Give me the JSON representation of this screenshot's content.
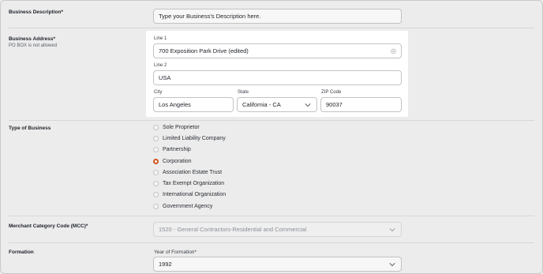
{
  "business_description": {
    "label": "Business Description*",
    "placeholder": "Type your Business's Description here."
  },
  "business_address": {
    "label": "Business Address*",
    "note": "PO BOX is not allowed",
    "line1_label": "Line 1",
    "line1_value": "700 Exposition Park Drive (edited)",
    "line2_label": "Line 2",
    "line2_value": "USA",
    "city_label": "City",
    "city_value": "Los Angeles",
    "state_label": "State",
    "state_value": "California - CA",
    "zip_label": "ZIP Code",
    "zip_value": "90037"
  },
  "type_of_business": {
    "label": "Type of Business",
    "selected": "Corporation",
    "options": [
      "Sole Proprietor",
      "Limited Liability Company",
      "Partnership",
      "Corporation",
      "Association Estate Trust",
      "Tax Exempt Organization",
      "International Organization",
      "Government Agency"
    ]
  },
  "mcc": {
    "label": "Merchant Category Code (MCC)*",
    "value": "1520 - General Contractors-Residential and Commercial"
  },
  "formation": {
    "label": "Formation",
    "year_label": "Year of Formation*",
    "year_value": "1992"
  },
  "colors": {
    "accent": "#d0581f",
    "background": "#ececec",
    "card": "#ffffff"
  },
  "icons": {
    "clear": "clear-icon",
    "dropdown": "chevron-down-icon"
  }
}
